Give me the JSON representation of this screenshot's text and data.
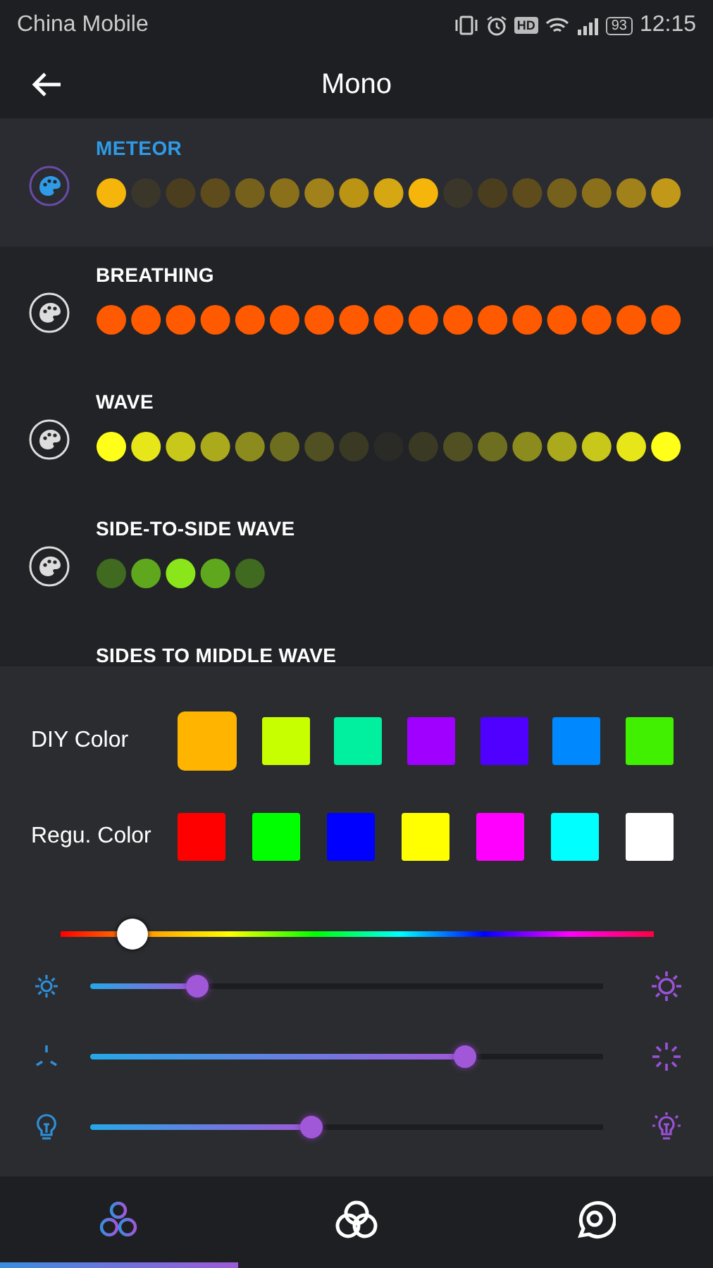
{
  "status_bar": {
    "carrier": "China Mobile",
    "hd": "HD",
    "battery": "93",
    "time": "12:15"
  },
  "header": {
    "title": "Mono"
  },
  "effects": [
    {
      "name": "METEOR",
      "selected": true,
      "dots": [
        {
          "color": "#f5b50a"
        },
        {
          "color": "#3a362a"
        },
        {
          "color": "#4a3e1f"
        },
        {
          "color": "#5e4c1c"
        },
        {
          "color": "#75601c"
        },
        {
          "color": "#8a701b"
        },
        {
          "color": "#a1821a"
        },
        {
          "color": "#bb9414"
        },
        {
          "color": "#d5a712"
        },
        {
          "color": "#f5b50a"
        },
        {
          "color": "#3a362a"
        },
        {
          "color": "#4a3e1f"
        },
        {
          "color": "#5e4c1c"
        },
        {
          "color": "#75601c"
        },
        {
          "color": "#8a701b"
        },
        {
          "color": "#a1821a"
        },
        {
          "color": "#c29818"
        }
      ]
    },
    {
      "name": "BREATHING",
      "selected": false,
      "dots": [
        {
          "color": "#ff5a00"
        },
        {
          "color": "#ff5a00"
        },
        {
          "color": "#ff5a00"
        },
        {
          "color": "#ff5a00"
        },
        {
          "color": "#ff5a00"
        },
        {
          "color": "#ff5a00"
        },
        {
          "color": "#ff5a00"
        },
        {
          "color": "#ff5a00"
        },
        {
          "color": "#ff5a00"
        },
        {
          "color": "#ff5a00"
        },
        {
          "color": "#ff5a00"
        },
        {
          "color": "#ff5a00"
        },
        {
          "color": "#ff5a00"
        },
        {
          "color": "#ff5a00"
        },
        {
          "color": "#ff5a00"
        },
        {
          "color": "#ff5a00"
        },
        {
          "color": "#ff5a00"
        }
      ]
    },
    {
      "name": "WAVE",
      "selected": false,
      "dots": [
        {
          "color": "#ffff1a"
        },
        {
          "color": "#e6e619"
        },
        {
          "color": "#c8c81a"
        },
        {
          "color": "#aaaa1c"
        },
        {
          "color": "#8c8c1e"
        },
        {
          "color": "#6e6e20"
        },
        {
          "color": "#505022"
        },
        {
          "color": "#3a3a24"
        },
        {
          "color": "#2a2a27"
        },
        {
          "color": "#3a3a24"
        },
        {
          "color": "#505022"
        },
        {
          "color": "#6e6e20"
        },
        {
          "color": "#8c8c1e"
        },
        {
          "color": "#aaaa1c"
        },
        {
          "color": "#c8c81a"
        },
        {
          "color": "#e6e619"
        },
        {
          "color": "#ffff1a"
        }
      ]
    },
    {
      "name": "SIDE-TO-SIDE WAVE",
      "selected": false,
      "dots": [
        {
          "color": "#3f6a1f"
        },
        {
          "color": "#5fa81e"
        },
        {
          "color": "#8ae61a"
        },
        {
          "color": "#5fa81e"
        },
        {
          "color": "#3f6a1f"
        }
      ]
    },
    {
      "name": "SIDES TO MIDDLE WAVE",
      "selected": false
    }
  ],
  "diy_color": {
    "label": "DIY Color",
    "swatches": [
      {
        "color": "#ffb400",
        "selected": true
      },
      {
        "color": "#c8ff00",
        "selected": false
      },
      {
        "color": "#00f0a0",
        "selected": false
      },
      {
        "color": "#a000ff",
        "selected": false
      },
      {
        "color": "#5000ff",
        "selected": false
      },
      {
        "color": "#0088ff",
        "selected": false
      },
      {
        "color": "#40f000",
        "selected": false
      }
    ]
  },
  "regular_color": {
    "label": "Regu. Color",
    "swatches": [
      {
        "color": "#ff0000",
        "selected": false
      },
      {
        "color": "#00ff00",
        "selected": false
      },
      {
        "color": "#0000ff",
        "selected": false
      },
      {
        "color": "#ffff00",
        "selected": false
      },
      {
        "color": "#ff00ff",
        "selected": false
      },
      {
        "color": "#00ffff",
        "selected": false
      },
      {
        "color": "#ffffff",
        "selected": false
      }
    ]
  },
  "hue_slider": {
    "level": 0.12
  },
  "sliders": [
    {
      "kind": "brightness",
      "level": 0.21
    },
    {
      "kind": "speed",
      "level": 0.73
    },
    {
      "kind": "light",
      "level": 0.43
    }
  ],
  "bottom_nav": [
    {
      "kind": "mono",
      "selected": true
    },
    {
      "kind": "mix",
      "selected": false
    },
    {
      "kind": "music",
      "selected": false
    }
  ]
}
